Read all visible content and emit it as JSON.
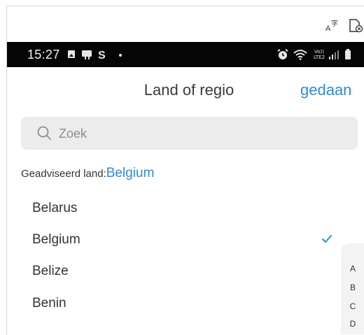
{
  "status_bar": {
    "time": "15:27",
    "network_label": "VoLTE2"
  },
  "header": {
    "title": "Land of regio",
    "done_label": "gedaan"
  },
  "search": {
    "placeholder": "Zoek",
    "value": ""
  },
  "suggested": {
    "label": "Geadviseerd land:",
    "country": "Belgium"
  },
  "countries": [
    {
      "name": "Belarus",
      "selected": false
    },
    {
      "name": "Belgium",
      "selected": true
    },
    {
      "name": "Belize",
      "selected": false
    },
    {
      "name": "Benin",
      "selected": false
    }
  ],
  "alphabet_index": [
    "A",
    "B",
    "C",
    "D"
  ],
  "colors": {
    "accent": "#2e8bdb",
    "status_bar": "#050505",
    "search_bg": "#ececec",
    "text": "#333333"
  },
  "icons": [
    "translate-icon",
    "document-icon",
    "search-icon",
    "check-icon",
    "alarm-icon",
    "wifi-icon",
    "signal-icon",
    "battery-icon"
  ]
}
